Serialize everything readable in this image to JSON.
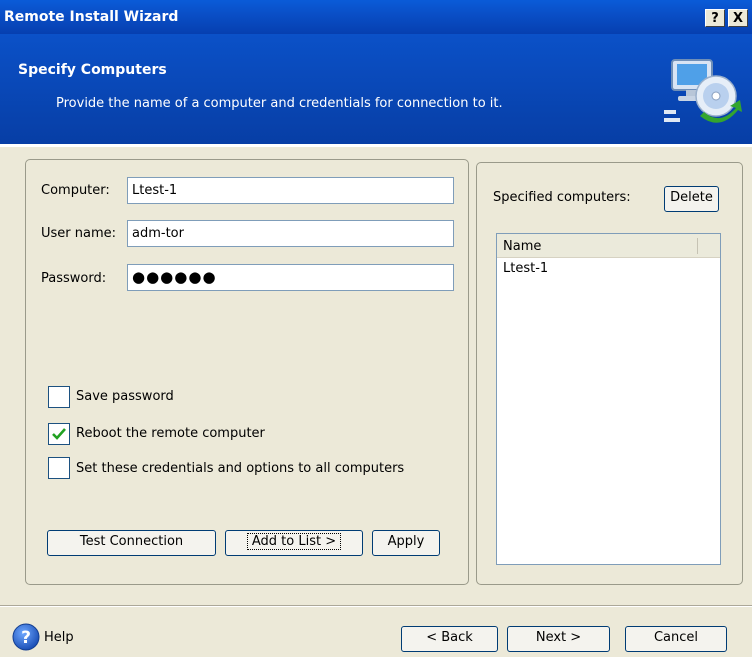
{
  "window": {
    "title": "Remote Install Wizard",
    "help_btn": "?",
    "close_btn": "X"
  },
  "header": {
    "title": "Specify Computers",
    "subtitle": "Provide the name of a computer and credentials for connection to it."
  },
  "form": {
    "computer_label": "Computer:",
    "computer_value": "Ltest-1",
    "username_label": "User name:",
    "username_value": "adm-tor",
    "password_label": "Password:",
    "password_value": "●●●●●●"
  },
  "options": [
    {
      "label": "Save password",
      "checked": false
    },
    {
      "label": "Reboot the remote computer",
      "checked": true
    },
    {
      "label": "Set these credentials and options to all computers",
      "checked": false
    }
  ],
  "actions": {
    "test_connection": "Test Connection",
    "add_to_list": "Add to List >",
    "apply": "Apply"
  },
  "specified": {
    "label": "Specified computers:",
    "delete": "Delete",
    "column": "Name",
    "rows": [
      "Ltest-1"
    ]
  },
  "footer": {
    "help": "Help",
    "back": "< Back",
    "next": "Next >",
    "cancel": "Cancel"
  },
  "colors": {
    "titlebar": "#0a5bd8",
    "header": "#0b51c8",
    "face": "#ece9d8",
    "check": "#21a121"
  }
}
